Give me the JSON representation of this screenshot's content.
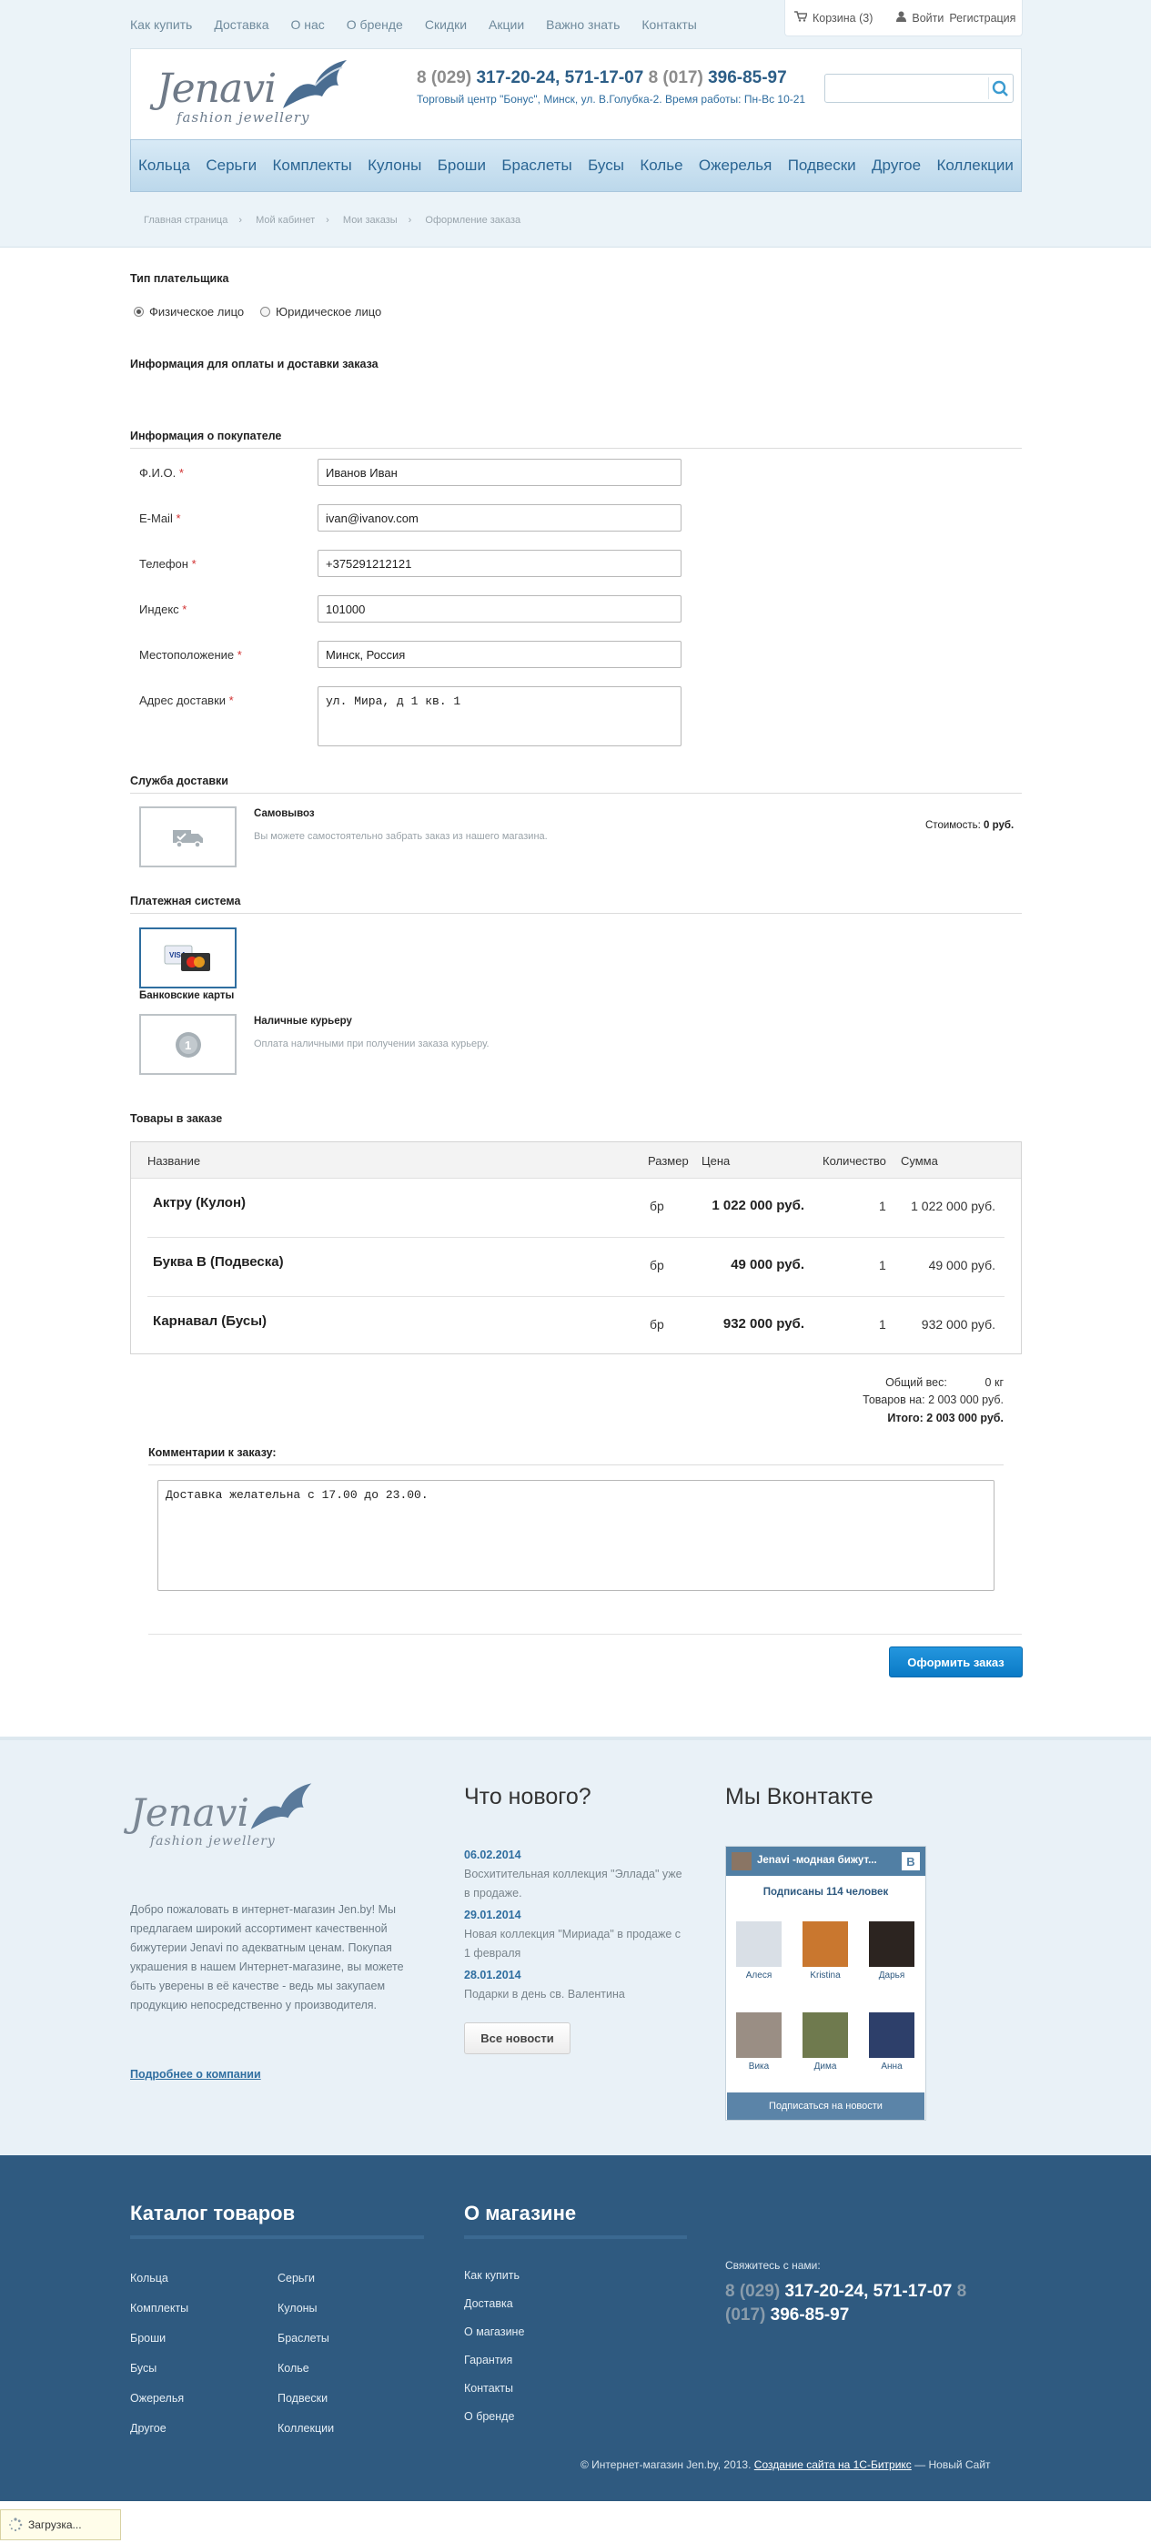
{
  "topnav": [
    "Как купить",
    "Доставка",
    "О нас",
    "О бренде",
    "Скидки",
    "Акции",
    "Важно знать",
    "Контакты"
  ],
  "user": {
    "cart": "Корзина (3)",
    "login": "Войти",
    "register": "Регистрация"
  },
  "logo": {
    "word": "Jenavi",
    "sub": "fashion jewellery"
  },
  "phones": {
    "code1": "8 (029)",
    "nums1": "317-20-24, 571-17-07",
    "code2": "8 (017)",
    "nums2": "396-85-97"
  },
  "address": "Торговый центр \"Бонус\", Минск, ул. В.Голубка-2. Время работы: Пн-Вс 10-21",
  "search": {
    "value": ""
  },
  "catnav": [
    "Кольца",
    "Серьги",
    "Комплекты",
    "Кулоны",
    "Броши",
    "Браслеты",
    "Бусы",
    "Колье",
    "Ожерелья",
    "Подвески",
    "Другое",
    "Коллекции"
  ],
  "breadcrumbs": [
    "Главная страница",
    "Мой кабинет",
    "Мои заказы",
    "Оформление заказа"
  ],
  "payer_type": {
    "title": "Тип плательщика",
    "options": [
      "Физическое лицо",
      "Юридическое лицо"
    ],
    "selected": "Физическое лицо"
  },
  "info_title": "Информация для оплаты и доставки заказа",
  "buyer": {
    "title": "Информация о покупателе",
    "fields": [
      {
        "label": "Ф.И.О.",
        "value": "Иванов Иван"
      },
      {
        "label": "E-Mail",
        "value": "ivan@ivanov.com"
      },
      {
        "label": "Телефон",
        "value": "+375291212121"
      },
      {
        "label": "Индекс",
        "value": "101000"
      },
      {
        "label": "Местоположение",
        "value": "Минск, Россия"
      },
      {
        "label": "Адрес доставки",
        "value": "ул. Мира, д 1 кв. 1"
      }
    ]
  },
  "delivery": {
    "title": "Служба доставки",
    "name": "Самовывоз",
    "desc": "Вы можете самостоятельно забрать заказ из нашего магазина.",
    "cost_label": "Стоимость:",
    "cost": "0 руб."
  },
  "payment": {
    "title": "Платежная система",
    "cards_label": "Банковские карты",
    "cash_name": "Наличные курьеру",
    "cash_desc": "Оплата наличными при получении заказа курьеру."
  },
  "order": {
    "title": "Товары в заказе",
    "headers": [
      "Название",
      "Размер",
      "Цена",
      "Количество",
      "Сумма"
    ],
    "rows": [
      {
        "name": "Актру (Кулон)",
        "size": "бр",
        "price": "1 022 000 руб.",
        "qty": "1",
        "sum": "1 022 000 руб."
      },
      {
        "name": "Буква В (Подвеска)",
        "size": "бр",
        "price": "49 000 руб.",
        "qty": "1",
        "sum": "49 000 руб."
      },
      {
        "name": "Карнавал (Бусы)",
        "size": "бр",
        "price": "932 000 руб.",
        "qty": "1",
        "sum": "932 000 руб."
      }
    ]
  },
  "totals": {
    "weight_label": "Общий вес:",
    "weight": "0 кг",
    "goods_label": "Товаров на:",
    "goods": "2 003 000 руб.",
    "total_label": "Итого:",
    "total": "2 003 000 руб."
  },
  "comment": {
    "title": "Комментарии к заказу:",
    "value": "Доставка желательна с 17.00 до 23.00."
  },
  "submit_label": "Оформить заказ",
  "footer": {
    "about": "Добро пожаловать в интернет-магазин Jen.by! Мы предлагаем широкий ассортимент качественной бижутерии Jenavi по адекватным ценам. Покупая украшения в нашем Интернет-магазине, вы можете быть уверены в её качестве - ведь мы закупаем продукцию непосредственно у производителя.",
    "about_link": "Подробнее о компании",
    "news_title": "Что нового?",
    "news": [
      {
        "date": "06.02.2014",
        "text": "Восхитительная коллекция \"Эллада\" уже в продаже."
      },
      {
        "date": "29.01.2014",
        "text": "Новая коллекция \"Мириада\" в продаже с 1 февраля"
      },
      {
        "date": "28.01.2014",
        "text": "Подарки в день св. Валентина"
      }
    ],
    "all_news": "Все новости",
    "vk_title": "Мы Вконтакте",
    "vk": {
      "group": "Jenavi -модная бижут...",
      "logo": "В",
      "subs": "Подписаны 114 человек",
      "members": [
        "Алеся",
        "Kristina",
        "Дарья",
        "Вика",
        "Дима",
        "Анна"
      ],
      "button": "Подписаться на новости"
    },
    "catalog_title": "Каталог товаров",
    "catalog_col1": [
      "Кольца",
      "Комплекты",
      "Броши",
      "Бусы",
      "Ожерелья",
      "Другое"
    ],
    "catalog_col2": [
      "Серьги",
      "Кулоны",
      "Браслеты",
      "Колье",
      "Подвески",
      "Коллекции"
    ],
    "shop_title": "О магазине",
    "shop_links": [
      "Как купить",
      "Доставка",
      "О магазине",
      "Гарантия",
      "Контакты",
      "О бренде"
    ],
    "contact_label": "Свяжитесь с нами:",
    "copyright_pre": "© Интернет-магазин Jen.by, 2013.",
    "copyright_link": "Создание сайта на 1С-Битрикс",
    "copyright_post": "— Новый Сайт"
  },
  "loading": "Загрузка...",
  "colors": {
    "accent": "#2f6ea0",
    "button": "#1087d2",
    "footer_dark": "#2f5a80",
    "nav": "#2a6593"
  }
}
